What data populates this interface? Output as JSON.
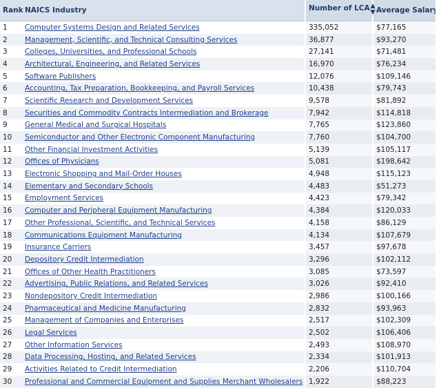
{
  "table": {
    "headers": {
      "rank": "Rank",
      "industry": "NAICS Industry",
      "count": "Number of LCA",
      "salary": "Average Salary"
    },
    "sort_icon": "sort-arrows-icon",
    "rows": [
      {
        "rank": "1",
        "industry": "Computer Systems Design and Related Services",
        "count": "335,052",
        "salary": "$77,165"
      },
      {
        "rank": "2",
        "industry": "Management, Scientific, and Technical Consulting Services",
        "count": "36,877",
        "salary": "$93,270"
      },
      {
        "rank": "3",
        "industry": "Colleges, Universities, and Professional Schools",
        "count": "27,141",
        "salary": "$71,481"
      },
      {
        "rank": "4",
        "industry": "Architectural, Engineering, and Related Services",
        "count": "16,970",
        "salary": "$76,234"
      },
      {
        "rank": "5",
        "industry": "Software Publishers",
        "count": "12,076",
        "salary": "$109,146"
      },
      {
        "rank": "6",
        "industry": "Accounting, Tax Preparation, Bookkeeping, and Payroll Services",
        "count": "10,438",
        "salary": "$79,743"
      },
      {
        "rank": "7",
        "industry": "Scientific Research and Development Services",
        "count": "9,578",
        "salary": "$81,892"
      },
      {
        "rank": "8",
        "industry": "Securities and Commodity Contracts Intermediation and Brokerage",
        "count": "7,942",
        "salary": "$114,818"
      },
      {
        "rank": "9",
        "industry": "General Medical and Surgical Hospitals",
        "count": "7,765",
        "salary": "$123,860"
      },
      {
        "rank": "10",
        "industry": "Semiconductor and Other Electronic Component Manufacturing",
        "count": "7,760",
        "salary": "$104,700"
      },
      {
        "rank": "11",
        "industry": "Other Financial Investment Activities",
        "count": "5,139",
        "salary": "$105,117"
      },
      {
        "rank": "12",
        "industry": "Offices of Physicians",
        "count": "5,081",
        "salary": "$198,642"
      },
      {
        "rank": "13",
        "industry": "Electronic Shopping and Mail-Order Houses",
        "count": "4,948",
        "salary": "$115,123"
      },
      {
        "rank": "14",
        "industry": "Elementary and Secondary Schools",
        "count": "4,483",
        "salary": "$51,273"
      },
      {
        "rank": "15",
        "industry": "Employment Services",
        "count": "4,423",
        "salary": "$79,342"
      },
      {
        "rank": "16",
        "industry": "Computer and Peripheral Equipment Manufacturing",
        "count": "4,384",
        "salary": "$120,033"
      },
      {
        "rank": "17",
        "industry": "Other Professional, Scientific, and Technical Services",
        "count": "4,158",
        "salary": "$86,129"
      },
      {
        "rank": "18",
        "industry": "Communications Equipment Manufacturing",
        "count": "4,134",
        "salary": "$107,679"
      },
      {
        "rank": "19",
        "industry": "Insurance Carriers",
        "count": "3,457",
        "salary": "$97,678"
      },
      {
        "rank": "20",
        "industry": "Depository Credit Intermediation",
        "count": "3,296",
        "salary": "$102,112"
      },
      {
        "rank": "21",
        "industry": "Offices of Other Health Practitioners",
        "count": "3,085",
        "salary": "$73,597"
      },
      {
        "rank": "22",
        "industry": "Advertising, Public Relations, and Related Services",
        "count": "3,026",
        "salary": "$92,410"
      },
      {
        "rank": "23",
        "industry": "Nondepository Credit Intermediation",
        "count": "2,986",
        "salary": "$100,166"
      },
      {
        "rank": "24",
        "industry": "Pharmaceutical and Medicine Manufacturing",
        "count": "2,832",
        "salary": "$93,963"
      },
      {
        "rank": "25",
        "industry": "Management of Companies and Enterprises",
        "count": "2,517",
        "salary": "$102,309"
      },
      {
        "rank": "26",
        "industry": "Legal Services",
        "count": "2,502",
        "salary": "$106,406"
      },
      {
        "rank": "27",
        "industry": "Other Information Services",
        "count": "2,493",
        "salary": "$108,970"
      },
      {
        "rank": "28",
        "industry": "Data Processing, Hosting, and Related Services",
        "count": "2,334",
        "salary": "$101,913"
      },
      {
        "rank": "29",
        "industry": "Activities Related to Credit Intermediation",
        "count": "2,206",
        "salary": "$110,704"
      },
      {
        "rank": "30",
        "industry": "Professional and Commercial Equipment and Supplies Merchant Wholesalers",
        "count": "1,922",
        "salary": "$88,223"
      }
    ]
  }
}
